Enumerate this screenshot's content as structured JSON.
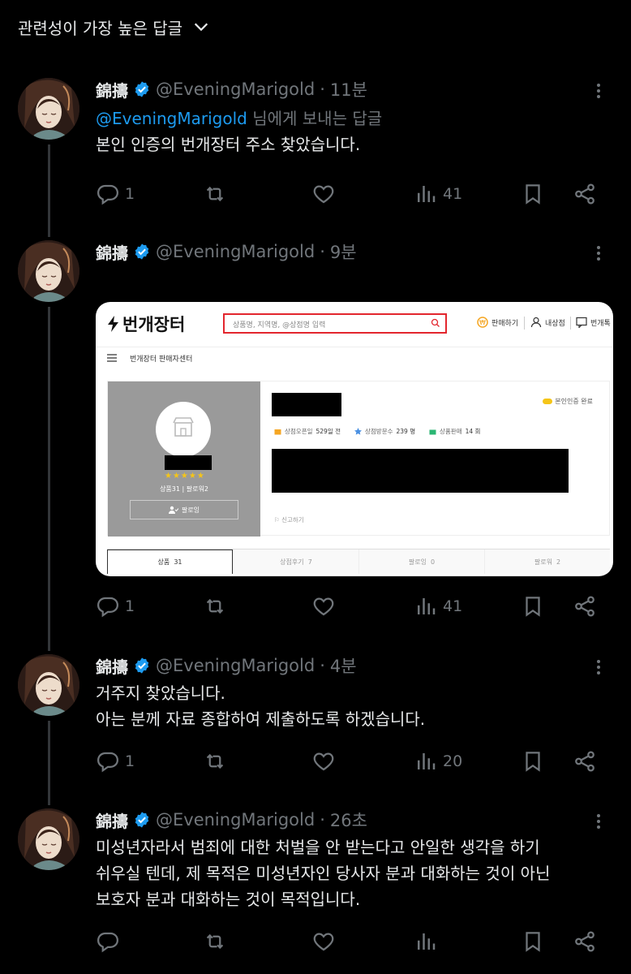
{
  "sort": {
    "label": "관련성이 가장 높은 답글"
  },
  "colors": {
    "accent": "#1d9bf0",
    "muted": "#71767b",
    "text": "#e7e9ea",
    "verified": "#1d9bf0"
  },
  "tweets": [
    {
      "name": "錦擣",
      "handle": "@EveningMarigold",
      "dot": "·",
      "time": "11분",
      "reply_mention": "@EveningMarigold",
      "reply_suffix": " 님에게 보내는 답글",
      "lines": [
        "본인 인증의 번개장터 주소 찾았습니다."
      ],
      "replies": "1",
      "retweets": "",
      "likes": "",
      "views": "41"
    },
    {
      "name": "錦擣",
      "handle": "@EveningMarigold",
      "dot": "·",
      "time": "9분",
      "lines": [],
      "replies": "1",
      "retweets": "",
      "likes": "",
      "views": "41"
    },
    {
      "name": "錦擣",
      "handle": "@EveningMarigold",
      "dot": "·",
      "time": "4분",
      "lines": [
        "거주지 찾았습니다.",
        "아는 분께 자료 종합하여 제출하도록 하겠습니다."
      ],
      "replies": "1",
      "retweets": "",
      "likes": "",
      "views": "20"
    },
    {
      "name": "錦擣",
      "handle": "@EveningMarigold",
      "dot": "·",
      "time": "26초",
      "lines": [
        "미성년자라서 범죄에 대한 처벌을 안 받는다고 안일한 생각을 하기",
        "쉬우실 텐데, 제 목적은 미성년자인 당사자 분과 대화하는 것이 아닌",
        "보호자 분과 대화하는 것이 목적입니다."
      ],
      "replies": "",
      "retweets": "",
      "likes": "",
      "views": ""
    }
  ],
  "media": {
    "logo": "번개장터",
    "search_placeholder": "상품명, 지역명, @상점명 입력",
    "nav": [
      "판매하기",
      "내상점",
      "번개톡"
    ],
    "sub_menu": "번개장터 판매자센터",
    "stars": "★★★★★",
    "shop_stats": "상품31  |  팔로워2",
    "follow_label": "팔로잉",
    "verified_badge": "본인인증 완료",
    "meta": [
      {
        "label": "상점오픈일",
        "value": "529일 전"
      },
      {
        "label": "상점방문수",
        "value": "239 명"
      },
      {
        "label": "상품판매",
        "value": "14 회"
      }
    ],
    "report": "신고하기",
    "tabs": [
      {
        "label": "상품",
        "count": "31"
      },
      {
        "label": "상점후기",
        "count": "7"
      },
      {
        "label": "팔로잉",
        "count": "0"
      },
      {
        "label": "팔로워",
        "count": "2"
      }
    ]
  }
}
